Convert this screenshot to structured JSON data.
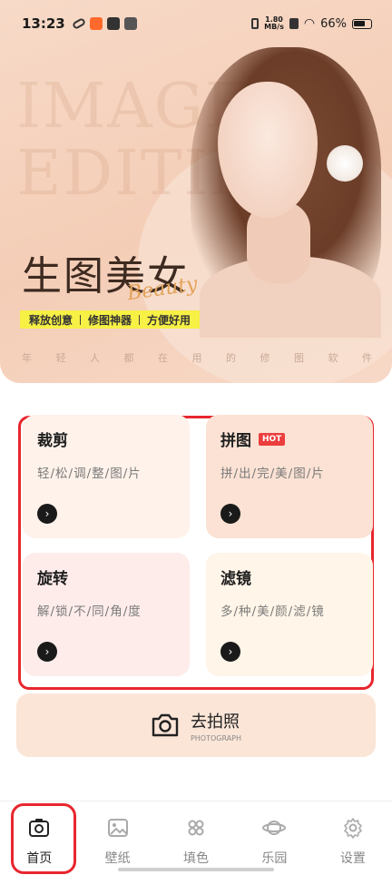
{
  "status_bar": {
    "time": "13:23",
    "speed_value": "1.80",
    "speed_unit": "MB/s",
    "battery": "66%"
  },
  "hero": {
    "watermark_line1": "IMAGE",
    "watermark_line2": "EDITING",
    "title": "生图美女",
    "script": "Beauty",
    "tags": [
      "释放创意",
      "修图神器",
      "方便好用"
    ],
    "subtitle_chars": [
      "年",
      "轻",
      "人",
      "都",
      "在",
      "用",
      "的",
      "修",
      "图",
      "软",
      "件"
    ]
  },
  "features": [
    {
      "title": "裁剪",
      "desc": "轻/松/调/整/图/片",
      "badge": ""
    },
    {
      "title": "拼图",
      "desc": "拼/出/完/美/图/片",
      "badge": "HOT"
    },
    {
      "title": "旋转",
      "desc": "解/锁/不/同/角/度",
      "badge": ""
    },
    {
      "title": "滤镜",
      "desc": "多/种/美/颜/滤/镜",
      "badge": ""
    }
  ],
  "photo_button": {
    "label": "去拍照",
    "sublabel": "PHOTOGRAPH"
  },
  "nav": [
    {
      "label": "首页",
      "icon": "camera-icon"
    },
    {
      "label": "壁纸",
      "icon": "image-icon"
    },
    {
      "label": "填色",
      "icon": "grid-icon"
    },
    {
      "label": "乐园",
      "icon": "planet-icon"
    },
    {
      "label": "设置",
      "icon": "gear-icon"
    }
  ],
  "colors": {
    "accent_red": "#e8262e",
    "tag_yellow": "#f7f045",
    "hero_bg": "#f4cdb6"
  }
}
